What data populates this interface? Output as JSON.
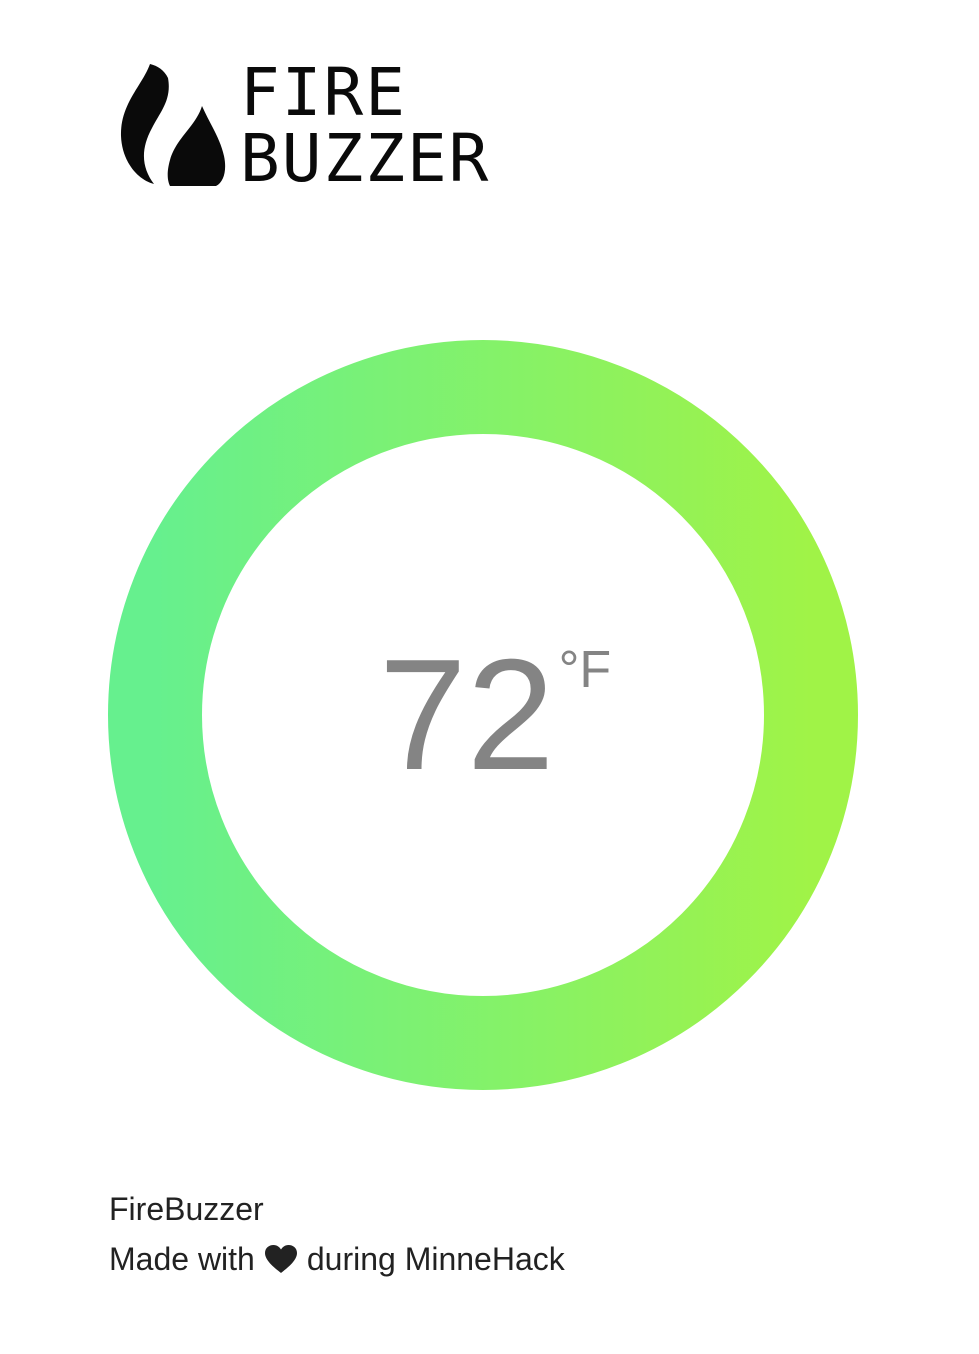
{
  "brand": {
    "line1": "FIRE",
    "line2": "BUZZER",
    "icon": "flame-icon"
  },
  "gauge": {
    "temperature": "72",
    "unit": "°F",
    "gradient_start": "#66f08e",
    "gradient_end": "#a0f347"
  },
  "footer": {
    "title": "FireBuzzer",
    "made_with": "Made with",
    "heart_icon": "heart-icon",
    "during": "during MinneHack"
  }
}
